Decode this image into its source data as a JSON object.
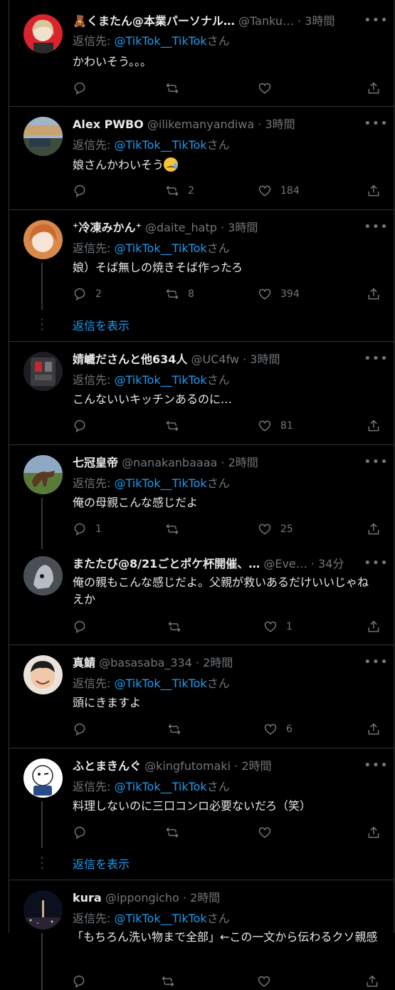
{
  "reply_prefix": "返信先: ",
  "reply_suffix": "さん",
  "more_glyph": "•••",
  "show_replies_label": "返信を表示",
  "colors": {
    "background": "#000000",
    "text": "#e7e9ea",
    "muted": "#71767b",
    "link": "#1d9bf0",
    "border": "#2f3336"
  },
  "tweets": [
    {
      "name": "🧸くまたん@本業パーソナル…",
      "handle": "@Tanku…",
      "time": "· 3時間",
      "reply_to": "@TikTok__TikTok",
      "text": "かわいそう。。。",
      "replies": "",
      "retweets": "",
      "likes": ""
    },
    {
      "name": "Alex PWBO",
      "handle": "@ilikemanyandiwa",
      "time": "· 3時間",
      "reply_to": "@TikTok__TikTok",
      "text": "娘さんかわいそう",
      "replies": "",
      "retweets": "2",
      "likes": "184"
    },
    {
      "name": "⁺冷凍みかん⁺",
      "handle": "@daite_hatp",
      "time": "· 3時間",
      "reply_to": "@TikTok__TikTok",
      "text": "娘）そば無しの焼きそば作ったろ",
      "replies": "2",
      "retweets": "8",
      "likes": "394"
    },
    {
      "name": "婧巇ださんと他634人",
      "handle": "@UC4fw",
      "time": "· 3時間",
      "reply_to": "@TikTok__TikTok",
      "text": "こんないいキッチンあるのに…",
      "replies": "",
      "retweets": "",
      "likes": "81"
    },
    {
      "name": "七冠皇帝",
      "handle": "@nanakanbaaaa",
      "time": "· 2時間",
      "reply_to": "@TikTok__TikTok",
      "text": "俺の母親こんな感じだよ",
      "replies": "1",
      "retweets": "",
      "likes": "25"
    },
    {
      "name": "またたび@8/21ごとポケ杯開催、…",
      "handle": "@Eve…",
      "time": "· 34分",
      "reply_to": "",
      "text": "俺の親もこんな感じだよ。父親が救いあるだけいいじゃねえか",
      "replies": "",
      "retweets": "",
      "likes": "1"
    },
    {
      "name": "真鯖",
      "handle": "@basasaba_334",
      "time": "· 2時間",
      "reply_to": "@TikTok__TikTok",
      "text": "頭にきますよ",
      "replies": "",
      "retweets": "",
      "likes": "6"
    },
    {
      "name": "ふとまきんぐ",
      "handle": "@kingfutomaki",
      "time": "· 2時間",
      "reply_to": "@TikTok__TikTok",
      "text": "料理しないのに三口コンロ必要ないだろ（笑）",
      "replies": "",
      "retweets": "",
      "likes": ""
    },
    {
      "name": "kura",
      "handle": "@ippongicho",
      "time": "· 2時間",
      "reply_to": "@TikTok__TikTok",
      "text": "「もちろん洗い物まで全部」←この一文から伝わるクソ親感",
      "replies": "",
      "retweets": "",
      "likes": ""
    }
  ]
}
